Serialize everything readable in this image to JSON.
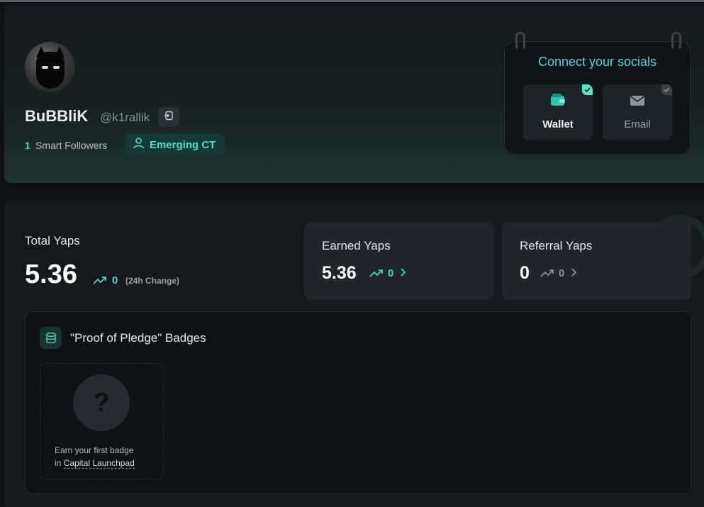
{
  "profile": {
    "username": "BuBBliK",
    "handle": "@k1rallik",
    "smart_followers_count": "1",
    "smart_followers_label": "Smart Followers",
    "badge_label": "Emerging CT"
  },
  "socials": {
    "title": "Connect your socials",
    "items": [
      {
        "label": "Wallet",
        "connected": true
      },
      {
        "label": "Email",
        "connected": false
      }
    ]
  },
  "stats": {
    "total_label": "Total Yaps",
    "total_value": "5.36",
    "total_change": "0",
    "total_change_label": "(24h Change)",
    "earned": {
      "title": "Earned Yaps",
      "value": "5.36",
      "change": "0"
    },
    "referral": {
      "title": "Referral Yaps",
      "value": "0",
      "change": "0"
    }
  },
  "badges": {
    "title": "\"Proof of Pledge\" Badges",
    "empty_line1": "Earn your first badge",
    "empty_line2_prefix": "in",
    "empty_link": "Capital Launchpad",
    "placeholder_glyph": "?"
  },
  "colors": {
    "accent": "#4ad6bf",
    "socials_title": "#4fd4e0",
    "background": "#0f1114"
  }
}
